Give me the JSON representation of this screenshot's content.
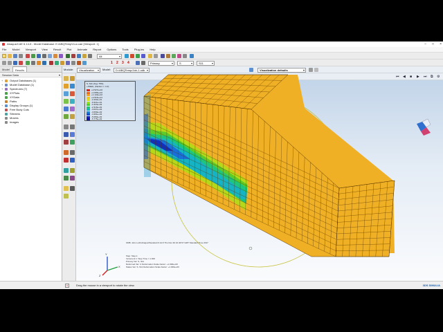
{
  "window": {
    "title": "Abaqus/CAE 6.14-5 - Model Database: E:\\ABQTemp\\Cuo.cae [Viewport: 1]",
    "controls": [
      "–",
      "□",
      "×"
    ]
  },
  "menubar": [
    "File",
    "Model",
    "Viewport",
    "View",
    "Result",
    "Plot",
    "Animate",
    "Report",
    "Options",
    "Tools",
    "Plug-ins",
    "Help"
  ],
  "toolbar": {
    "filter_value": "All",
    "step_label": "Primary",
    "field_value": "S",
    "component_value": "S11",
    "visualization_defaults": "Visualization defaults",
    "numbers": [
      "1",
      "2",
      "3",
      "4"
    ]
  },
  "module_bar": {
    "module_label": "Module:",
    "module_value": "Visualization",
    "model_label": "Model:",
    "model_value": "D:/ABQTemp/Job-1.odb"
  },
  "tree": {
    "tabs": [
      "Model",
      "Results"
    ],
    "session_label": "Session Data",
    "items": [
      {
        "label": "Output Databases (1)",
        "color": "#e0a03a",
        "expander": "+"
      },
      {
        "label": "Model Database (1)",
        "color": "#6d8fc9",
        "expander": "+"
      },
      {
        "label": "Spectrums (7)",
        "color": "#9a6fc0",
        "expander": "+"
      },
      {
        "label": "XYPlots",
        "color": "#4aa34a",
        "expander": ""
      },
      {
        "label": "XYData",
        "color": "#4aa34a",
        "expander": ""
      },
      {
        "label": "Paths",
        "color": "#c9822d",
        "expander": ""
      },
      {
        "label": "Display Groups (1)",
        "color": "#5a8fd0",
        "expander": "+"
      },
      {
        "label": "Free Body Cuts",
        "color": "#c05050",
        "expander": ""
      },
      {
        "label": "Streams",
        "color": "#4aa3a3",
        "expander": ""
      },
      {
        "label": "Movies",
        "color": "#8a8a8a",
        "expander": ""
      },
      {
        "label": "Images",
        "color": "#8a8a8a",
        "expander": ""
      }
    ]
  },
  "viewport_toolbar": {
    "buttons": [
      "⏮",
      "◀",
      "■",
      "▶",
      "⏭",
      "⧉",
      "⚙"
    ]
  },
  "legend": {
    "title": "S, S11 (Avg: 75%)",
    "subtitle": "+SNEG, (fraction = -1.0)",
    "entries": [
      {
        "value": "+2.527e+02",
        "color": "#d8281e"
      },
      {
        "value": "+1.835e+02",
        "color": "#ee6b1e"
      },
      {
        "value": "+1.143e+02",
        "color": "#f7a21f"
      },
      {
        "value": "+4.515e+01",
        "color": "#f2c81d"
      },
      {
        "value": "-2.403e+01",
        "color": "#dbe01c"
      },
      {
        "value": "-9.321e+01",
        "color": "#9fe01e"
      },
      {
        "value": "-1.624e+02",
        "color": "#4cd32a"
      },
      {
        "value": "-2.316e+02",
        "color": "#20c96e"
      },
      {
        "value": "-3.007e+02",
        "color": "#12b6c0"
      },
      {
        "value": "-3.699e+02",
        "color": "#1784d8"
      },
      {
        "value": "-4.391e+02",
        "color": "#1450d4"
      },
      {
        "value": "-5.083e+02",
        "color": "#1222b8"
      },
      {
        "value": "-5.775e+02",
        "color": "#0c10a0"
      }
    ]
  },
  "odb_info": "ODB: Job-1.odb    Abaqus/Standard 6.14-5    Thu Nov 30 10:46:57 GMT Standard Time 2017",
  "step_info": [
    "Step: Step-1",
    "Increment    1: Step Time =    1.000",
    "Primary Var: S, S11",
    "Deformed Var: U   Deformation Scale Factor: +1.000e+00",
    "Status Var: S, S11   Deformation Scale Factor: +1.000e+00"
  ],
  "triad": {
    "x": "X",
    "y": "Y",
    "z": "Z"
  },
  "status": {
    "message": "Drag the mouse in a viewport to rotate the view.",
    "brand": "3DS SIMULIA"
  }
}
